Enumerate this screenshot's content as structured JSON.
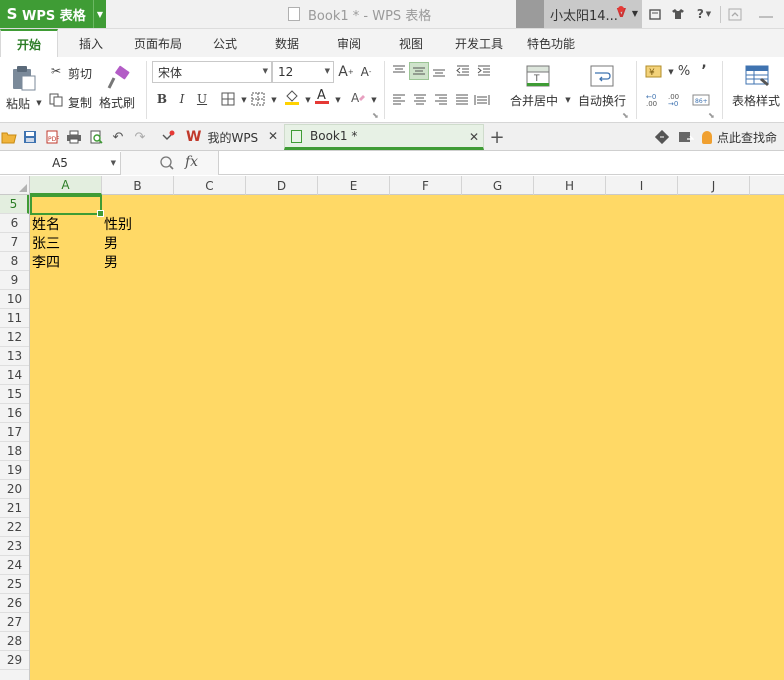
{
  "titlebar": {
    "app_name": "WPS 表格",
    "doc_title": "Book1 * - WPS 表格",
    "user_name": "小太阳14...",
    "help_label": "?"
  },
  "ribbon_tabs": [
    "开始",
    "插入",
    "页面布局",
    "公式",
    "数据",
    "审阅",
    "视图",
    "开发工具",
    "特色功能"
  ],
  "ribbon": {
    "paste": "粘贴",
    "cut": "剪切",
    "copy": "复制",
    "format_painter": "格式刷",
    "font_name": "宋体",
    "font_size": "12",
    "bold": "B",
    "italic": "I",
    "underline": "U",
    "merge_center": "合并居中",
    "wrap_text": "自动换行",
    "percent": "%",
    "comma": "’",
    "table_style": "表格样式",
    "currency_symbol": "¥"
  },
  "doc_tabs": {
    "my_wps": "我的WPS",
    "book": "Book1 *",
    "add": "+",
    "find_cmd": "点此查找命"
  },
  "formula_bar": {
    "name_box": "A5",
    "fx": "fx",
    "formula": ""
  },
  "columns": [
    "A",
    "B",
    "C",
    "D",
    "E",
    "F",
    "G",
    "H",
    "I",
    "J"
  ],
  "rows": [
    "5",
    "6",
    "7",
    "8",
    "9",
    "10",
    "11",
    "12",
    "13",
    "14",
    "15",
    "16",
    "17",
    "18",
    "19",
    "20",
    "21",
    "22",
    "23",
    "24",
    "25",
    "26",
    "27",
    "28",
    "29"
  ],
  "sheet_cells": {
    "a6": "姓名",
    "b6": "性别",
    "a7": "张三",
    "b7": "男",
    "a8": "李四",
    "b8": "男"
  },
  "colors": {
    "accent": "#3f9c35",
    "cell_fill": "#ffd966",
    "font_color_bar": "#e53935",
    "fill_color_bar": "#ffd200"
  }
}
